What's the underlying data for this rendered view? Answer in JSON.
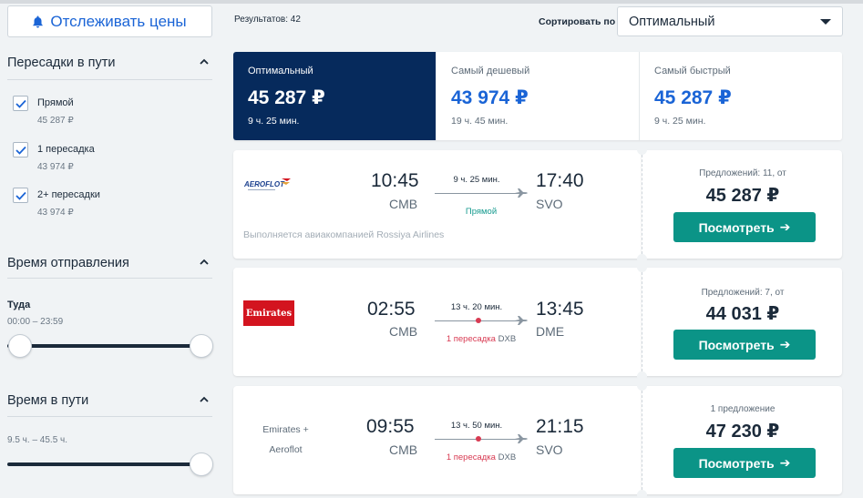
{
  "track_prices": {
    "label": "Отслеживать цены",
    "icon": "bell-icon"
  },
  "filters": {
    "transfers": {
      "title": "Пересадки в пути",
      "options": [
        {
          "label": "Прямой",
          "price": "45 287 ₽",
          "checked": true
        },
        {
          "label": "1 пересадка",
          "price": "43 974 ₽",
          "checked": true
        },
        {
          "label": "2+ пересадки",
          "price": "43 974 ₽",
          "checked": true
        }
      ]
    },
    "departure": {
      "title": "Время отправления",
      "direction": "Туда",
      "range": "00:00 – 23:59"
    },
    "travel_time": {
      "title": "Время в пути",
      "range": "9.5 ч. – 45.5 ч."
    }
  },
  "results": {
    "count_label": "Результатов: 42"
  },
  "sort": {
    "label": "Сортировать по",
    "value": "Оптимальный"
  },
  "tabs": [
    {
      "title": "Оптимальный",
      "price": "45 287 ₽",
      "duration": "9 ч. 25 мин.",
      "active": true
    },
    {
      "title": "Самый дешевый",
      "price": "43 974 ₽",
      "duration": "19 ч. 45 мин.",
      "active": false
    },
    {
      "title": "Самый быстрый",
      "price": "45 287 ₽",
      "duration": "9 ч. 25 мин.",
      "active": false
    }
  ],
  "flights": [
    {
      "airline_logo": "aeroflot-logo",
      "depart_time": "10:45",
      "depart_airport": "CMB",
      "arrive_time": "17:40",
      "arrive_airport": "SVO",
      "duration": "9 ч. 25 мин.",
      "stops": "Прямой",
      "stop_via": "",
      "operated_by": "Выполняется авиакомпанией Rossiya Airlines",
      "offers": "Предложений: 11, от",
      "price": "45 287 ₽",
      "button": "Посмотреть"
    },
    {
      "airline_logo": "emirates-logo",
      "logo_text": "Emirates",
      "depart_time": "02:55",
      "depart_airport": "CMB",
      "arrive_time": "13:45",
      "arrive_airport": "DME",
      "duration": "13 ч. 20 мин.",
      "stops": "1 пересадка",
      "stop_via": "DXB",
      "offers": "Предложений: 7, от",
      "price": "44 031 ₽",
      "button": "Посмотреть"
    },
    {
      "airline_names": [
        "Emirates +",
        "Aeroflot"
      ],
      "depart_time": "09:55",
      "depart_airport": "CMB",
      "arrive_time": "21:15",
      "arrive_airport": "SVO",
      "duration": "13 ч. 50 мин.",
      "stops": "1 пересадка",
      "stop_via": "DXB",
      "offers": "1 предложение",
      "price": "47 230 ₽",
      "button": "Посмотреть"
    }
  ],
  "colors": {
    "accent_blue": "#1a64d6",
    "active_tab": "#062a5c",
    "button_teal": "#0b9487",
    "transfer_red": "#d83a52",
    "direct_green": "#159a8e"
  }
}
